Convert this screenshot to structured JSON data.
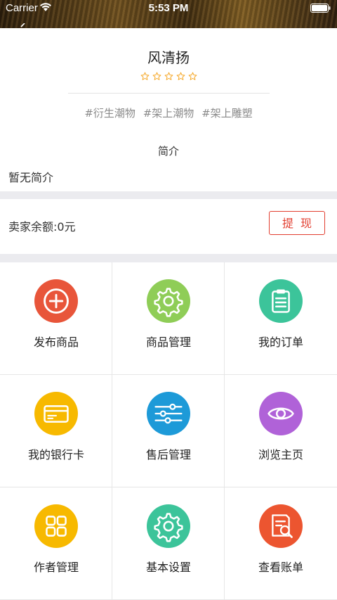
{
  "status_bar": {
    "carrier": "Carrier",
    "time": "5:53 PM"
  },
  "profile": {
    "name": "风清扬",
    "rating": 0,
    "rating_max": 5,
    "tags": [
      "#衍生潮物",
      "#架上潮物",
      "#架上雕塑"
    ],
    "intro_heading": "简介",
    "intro_text": "暂无简介"
  },
  "balance": {
    "label": "卖家余额:0元",
    "withdraw_label": "提现"
  },
  "menu": [
    {
      "label": "发布商品",
      "icon": "plus-circle-icon",
      "color": "#e8553a"
    },
    {
      "label": "商品管理",
      "icon": "gear-icon",
      "color": "#8fcd57"
    },
    {
      "label": "我的订单",
      "icon": "clipboard-icon",
      "color": "#3cc49a"
    },
    {
      "label": "我的银行卡",
      "icon": "bank-card-icon",
      "color": "#f7b900"
    },
    {
      "label": "售后管理",
      "icon": "sliders-icon",
      "color": "#1d9ad8"
    },
    {
      "label": "浏览主页",
      "icon": "eye-icon",
      "color": "#b062d8"
    },
    {
      "label": "作者管理",
      "icon": "grid-icon",
      "color": "#f7b900"
    },
    {
      "label": "基本设置",
      "icon": "gear-icon",
      "color": "#3cc49a"
    },
    {
      "label": "查看账单",
      "icon": "bill-search-icon",
      "color": "#ec5530"
    }
  ]
}
